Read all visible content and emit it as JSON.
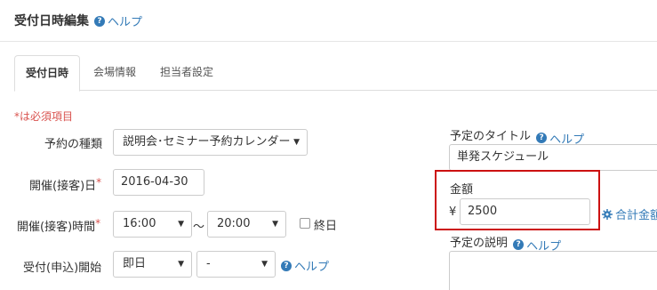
{
  "header": {
    "title": "受付日時編集",
    "help_label": "ヘルプ"
  },
  "tabs": [
    {
      "label": "受付日時",
      "active": true
    },
    {
      "label": "会場情報",
      "active": false
    },
    {
      "label": "担当者設定",
      "active": false
    }
  ],
  "form": {
    "required_note": "*は必須項目",
    "reservation_type": {
      "label": "予約の種類",
      "value": "説明会･セミナー予約カレンダー"
    },
    "event_date": {
      "label": "開催(接客)日",
      "required_mark": "*",
      "value": "2016-04-30"
    },
    "event_time": {
      "label": "開催(接客)時間",
      "required_mark": "*",
      "start": "16:00",
      "separator": "～",
      "end": "20:00",
      "all_day_label": "終日",
      "all_day_checked": false
    },
    "reception_start": {
      "label": "受付(申込)開始",
      "value": "即日",
      "sub_value": "-",
      "help_label": "ヘルプ"
    }
  },
  "right": {
    "title_label": "予定のタイトル",
    "title_help": "ヘルプ",
    "title_value": "単発スケジュール",
    "amount_label": "金額",
    "currency": "¥",
    "amount_value": "2500",
    "total_label": "合計金額",
    "description_label": "予定の説明",
    "description_help": "ヘルプ"
  },
  "colors": {
    "link": "#337ab7",
    "required": "#d9534f",
    "highlight_border": "#cc1111"
  },
  "icons": [
    "help-circle-icon",
    "caret-down-icon",
    "gear-icon"
  ]
}
